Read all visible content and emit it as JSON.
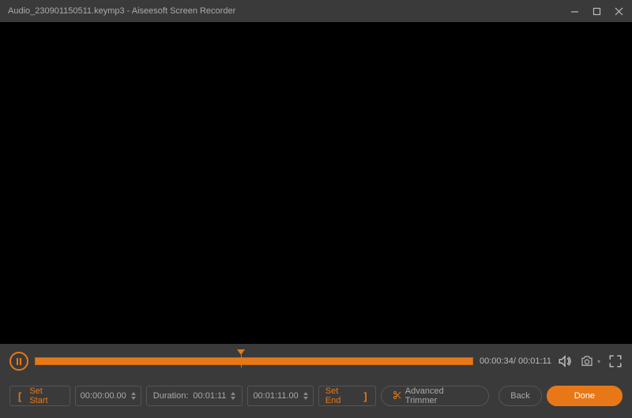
{
  "titlebar": {
    "filename": "Audio_230901150511.keymp3",
    "separator": "  -  ",
    "appname": "Aiseesoft Screen Recorder"
  },
  "playback": {
    "current_time": "00:00:34",
    "total_time": "00:01:11",
    "playhead_percent": 47
  },
  "toolbar": {
    "set_start_label": "Set Start",
    "start_time": "00:00:00.00",
    "duration_label": "Duration:",
    "duration_value": "00:01:11",
    "end_time": "00:01:11.00",
    "set_end_label": "Set End",
    "advanced_trimmer_label": "Advanced Trimmer",
    "back_label": "Back",
    "done_label": "Done"
  }
}
